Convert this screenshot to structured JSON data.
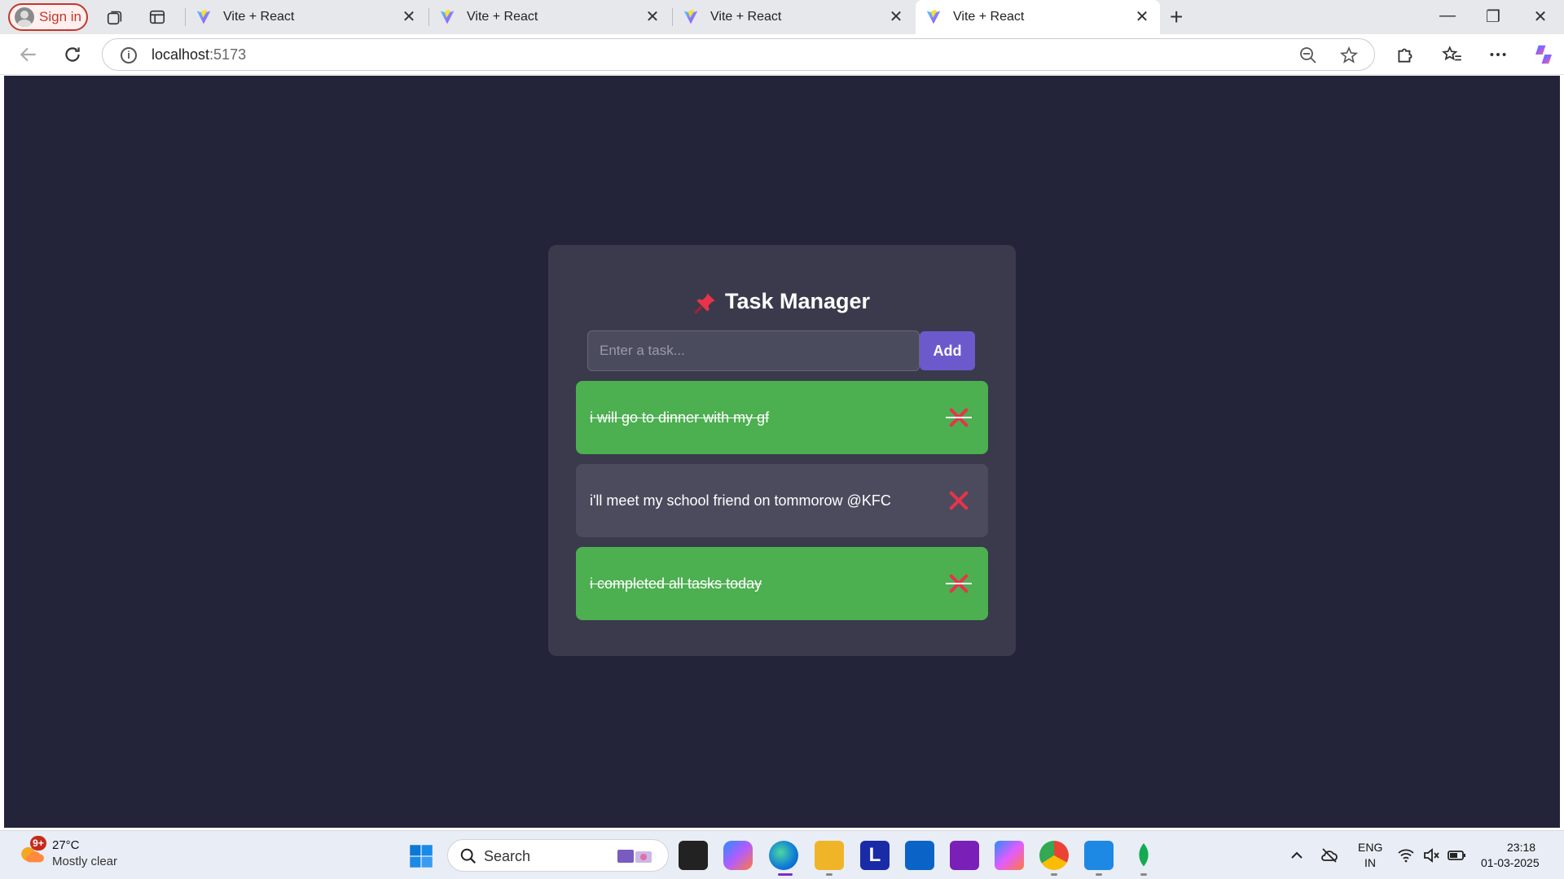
{
  "browser": {
    "signin_label": "Sign in",
    "tabs": [
      {
        "title": "Vite + React",
        "active": false
      },
      {
        "title": "Vite + React",
        "active": false
      },
      {
        "title": "Vite + React",
        "active": false
      },
      {
        "title": "Vite + React",
        "active": true
      }
    ],
    "new_tab_label": "+",
    "url_host": "localhost",
    "url_port": ":5173"
  },
  "app": {
    "title": "Task Manager",
    "title_icon": "pushpin-icon",
    "input_placeholder": "Enter a task...",
    "add_label": "Add",
    "tasks": [
      {
        "text": "i will go to dinner with my gf",
        "completed": true
      },
      {
        "text": "i'll meet my school friend on tommorow @KFC",
        "completed": false
      },
      {
        "text": "i completed all tasks today",
        "completed": true
      }
    ],
    "colors": {
      "page_bg": "#23233a",
      "card_bg": "#3a3a4c",
      "completed_bg": "#4caf50",
      "pending_bg": "#4c4b5e",
      "accent": "#6c5acd",
      "delete": "#e8334a"
    }
  },
  "taskbar": {
    "weather_badge": "9+",
    "temperature": "27°C",
    "condition": "Mostly clear",
    "search_label": "Search",
    "language_line1": "ENG",
    "language_line2": "IN",
    "time": "23:18",
    "date": "01-03-2025"
  }
}
